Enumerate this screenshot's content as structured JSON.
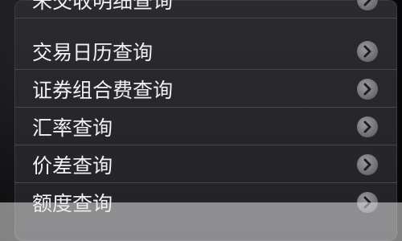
{
  "menu": {
    "items": [
      {
        "label": "未交收明细查询"
      },
      {
        "label": "交易日历查询"
      },
      {
        "label": "证券组合费查询"
      },
      {
        "label": "汇率查询"
      },
      {
        "label": "价差查询"
      },
      {
        "label": "额度查询"
      }
    ]
  },
  "colors": {
    "highlight_border": "#d11a1a",
    "highlight_fill": "#c87812",
    "panel_bg": "#2b2b2f",
    "text": "#f2f2f2"
  },
  "icons": {
    "row_chevron": "chevron-right-icon"
  }
}
